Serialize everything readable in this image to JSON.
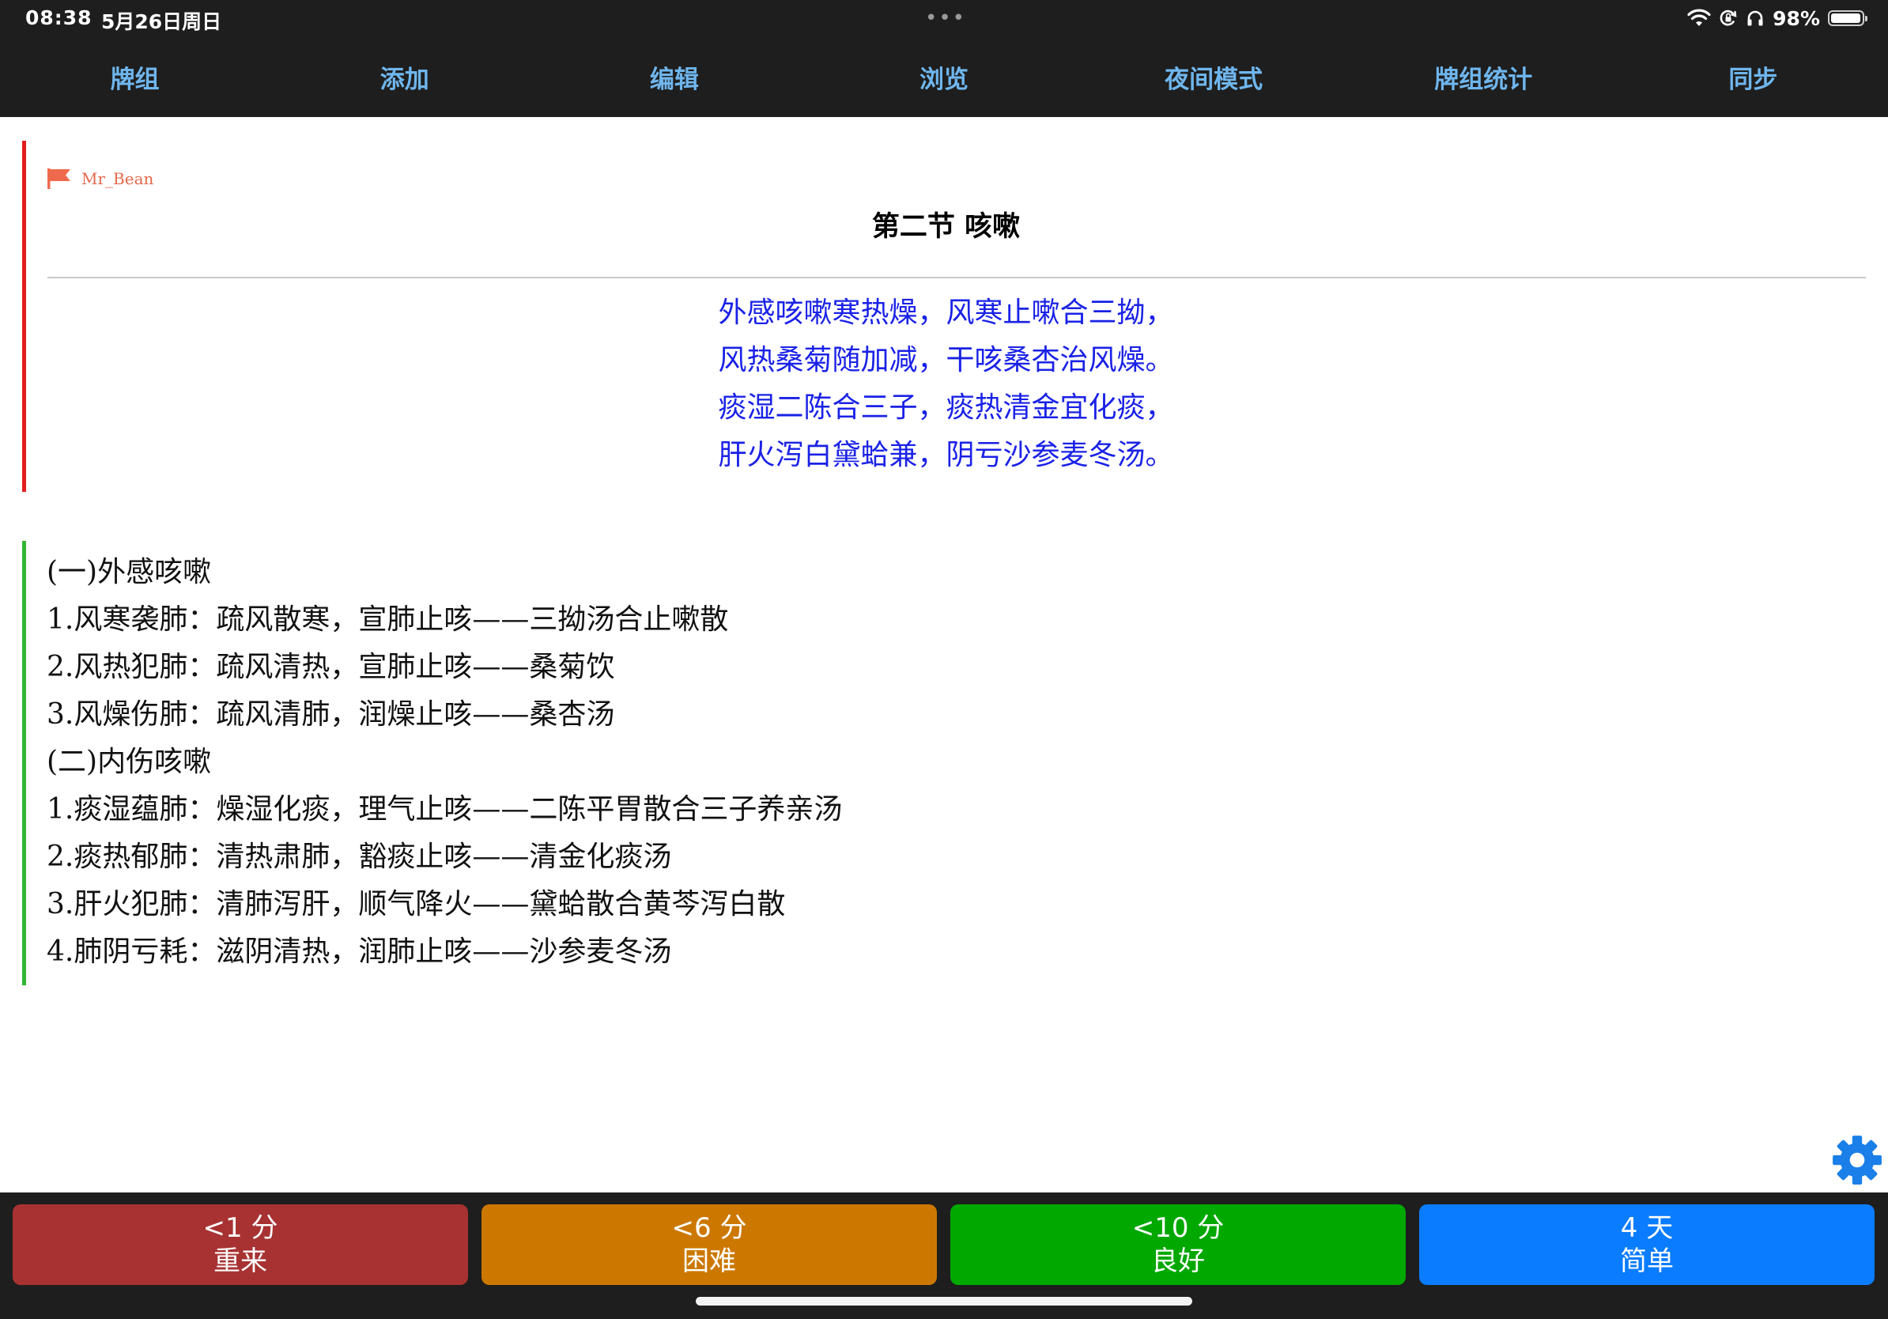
{
  "status_bar": {
    "time": "08:38",
    "date": "5月26日周日",
    "multitask_dots": "•••",
    "battery_percent": "98%",
    "battery_level": 0.98
  },
  "menu": {
    "items": [
      {
        "label": "牌组"
      },
      {
        "label": "添加"
      },
      {
        "label": "编辑"
      },
      {
        "label": "浏览"
      },
      {
        "label": "夜间模式"
      },
      {
        "label": "牌组统计"
      },
      {
        "label": "同步"
      }
    ]
  },
  "card": {
    "flag_label": "Mr_Bean",
    "title": "第二节 咳嗽",
    "verse": [
      "外感咳嗽寒热燥，风寒止嗽合三拗，",
      "风热桑菊随加减，干咳桑杏治风燥。",
      "痰湿二陈合三子，痰热清金宜化痰，",
      "肝火泻白黛蛤兼，阴亏沙参麦冬汤。"
    ],
    "answer": [
      "(一)外感咳嗽",
      "1.风寒袭肺：疏风散寒，宣肺止咳——三拗汤合止嗽散",
      "2.风热犯肺：疏风清热，宣肺止咳——桑菊饮",
      "3.风燥伤肺：疏风清肺，润燥止咳——桑杏汤",
      "(二)内伤咳嗽",
      "1.痰湿蕴肺：燥湿化痰，理气止咳——二陈平胃散合三子养亲汤",
      "2.痰热郁肺：清热肃肺，豁痰止咳——清金化痰汤",
      "3.肝火犯肺：清肺泻肝，顺气降火——黛蛤散合黄芩泻白散",
      "4.肺阴亏耗：滋阴清热，润肺止咳——沙参麦冬汤"
    ]
  },
  "answer_buttons": {
    "again": {
      "interval": "<1 分",
      "label": "重来",
      "color": "#a83232"
    },
    "hard": {
      "interval": "<6 分",
      "label": "困难",
      "color": "#cc7800"
    },
    "good": {
      "interval": "<10 分",
      "label": "良好",
      "color": "#00a800"
    },
    "easy": {
      "interval": "4 天",
      "label": "简单",
      "color": "#0a7cff"
    }
  },
  "colors": {
    "menu_text": "#6fb6ee",
    "bar_bg": "#1e1e1e",
    "front_border": "#e41c1c",
    "back_border": "#33b533",
    "verse_text": "#1a22e6",
    "flag": "#ef6a4c",
    "gear": "#1a7fe8"
  }
}
